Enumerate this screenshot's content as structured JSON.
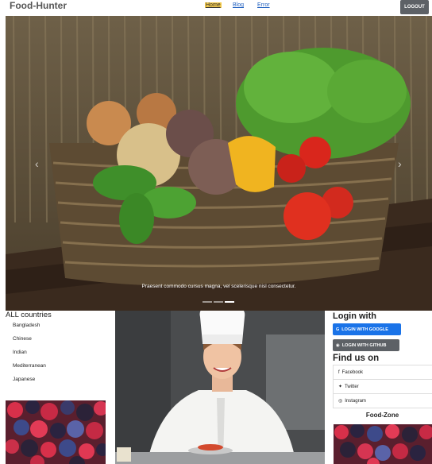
{
  "navbar": {
    "brand": "Food-Hunter",
    "links": [
      "Home",
      "Blog",
      "Error"
    ],
    "logout": "LOGOUT"
  },
  "carousel": {
    "caption": "Praesent commodo cursus magna, vel scelerisque nisl consectetur.",
    "slide_count": 3,
    "active_slide": 2
  },
  "countries": {
    "title": "ALL countries",
    "items": [
      "Bangladesh",
      "Chinese",
      "Indian",
      "Mediterranean",
      "Japanese"
    ]
  },
  "login": {
    "title": "Login with",
    "google": "LOGIN WITH GOOGLE",
    "github": "LOGIN WITH GITHUB"
  },
  "find_us": {
    "title": "Find us on",
    "items": [
      "Facebook",
      "Twitter",
      "Instagram"
    ]
  },
  "food_zone": {
    "title": "Food-Zone"
  },
  "colors": {
    "google": "#1a73e8",
    "github": "#5d6166",
    "active_nav": "#f2c94c"
  }
}
